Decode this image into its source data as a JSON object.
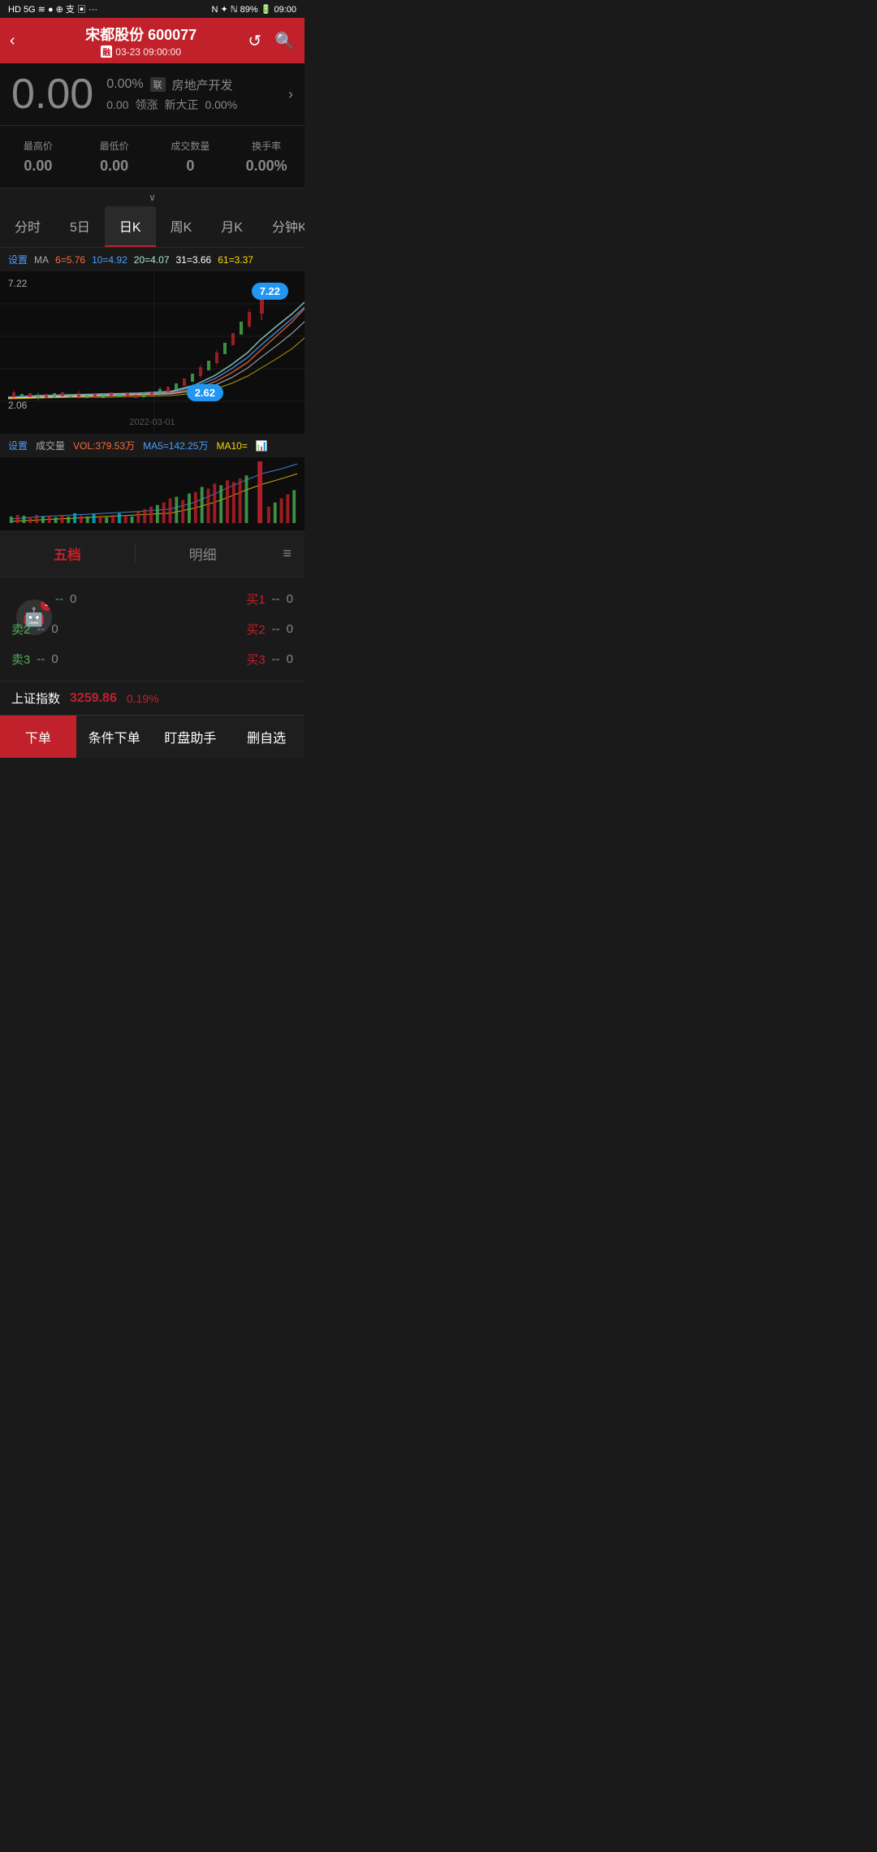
{
  "statusBar": {
    "left": "HD 5G  ⊙  ≋  ●  ⊕  支  ▣  ...",
    "right": "N  ✦  ℕ  89%  🔋  09:00"
  },
  "header": {
    "title": "宋都股份 600077",
    "subtitle": "03-23 09:00:00",
    "rongBadge": "融",
    "backLabel": "‹",
    "refreshLabel": "↺",
    "searchLabel": "🔍"
  },
  "price": {
    "main": "0.00",
    "changePct": "0.00%",
    "changeAmt": "0.00",
    "lianBadge": "联",
    "sector": "房地产开发",
    "leadLabel": "领涨",
    "leadName": "新大正",
    "leadChange": "0.00%"
  },
  "stats": {
    "highLabel": "最高价",
    "highValue": "0.00",
    "lowLabel": "最低价",
    "lowValue": "0.00",
    "volLabel": "成交数量",
    "volValue": "0",
    "turnLabel": "换手率",
    "turnValue": "0.00%"
  },
  "tabs": [
    {
      "label": "分时",
      "active": false
    },
    {
      "label": "5日",
      "active": false
    },
    {
      "label": "日K",
      "active": true
    },
    {
      "label": "周K",
      "active": false
    },
    {
      "label": "月K",
      "active": false
    },
    {
      "label": "分钟K",
      "active": false
    }
  ],
  "maRow": {
    "settingsLabel": "设置",
    "maLabel": "MA",
    "ma6Label": "6=5.76",
    "ma10Label": "10=4.92",
    "ma20Label": "20=4.07",
    "ma31Label": "31=3.66",
    "ma61Label": "61=3.37"
  },
  "chart": {
    "highPrice": "7.22",
    "lowPrice": "2.06",
    "badgeHigh": "7.22",
    "badgeLow": "2.62",
    "dateLabel": "2022-03-01"
  },
  "volRow": {
    "settingsLabel": "设置",
    "volLabel": "成交量",
    "volValue": "VOL:379.53万",
    "ma5Label": "MA5=142.25万",
    "ma10Label": "MA10=",
    "iconLabel": "📊"
  },
  "orderTabs": {
    "fiveLevelLabel": "五档",
    "detailLabel": "明细"
  },
  "orderBook": {
    "robotBadge": "3",
    "sellRows": [
      {
        "label": "卖1",
        "price": "--",
        "qty": "0"
      },
      {
        "label": "卖2",
        "price": "--",
        "qty": "0"
      },
      {
        "label": "卖3",
        "price": "--",
        "qty": "0"
      }
    ],
    "buyRows": [
      {
        "label": "买1",
        "price": "--",
        "qty": "0"
      },
      {
        "label": "买2",
        "price": "--",
        "qty": "0"
      },
      {
        "label": "买3",
        "price": "--",
        "qty": "0"
      }
    ]
  },
  "marketBar": {
    "name": "上证指数",
    "price": "3259.86",
    "change": "0.19%"
  },
  "bottomNav": [
    {
      "label": "下单",
      "primary": true
    },
    {
      "label": "条件下单",
      "primary": false
    },
    {
      "label": "盯盘助手",
      "primary": false
    },
    {
      "label": "删自选",
      "primary": false
    }
  ]
}
